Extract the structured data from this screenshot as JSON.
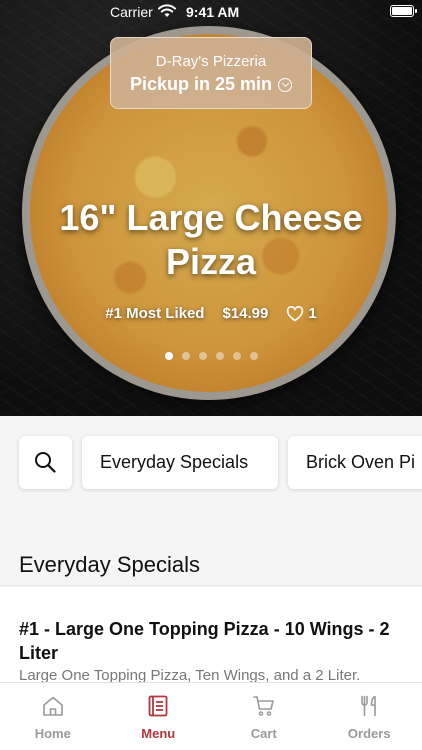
{
  "status_bar": {
    "carrier": "Carrier",
    "time": "9:41 AM"
  },
  "store": {
    "name": "D-Ray's Pizzeria",
    "pickup": "Pickup in 25 min"
  },
  "hero": {
    "title": "16\" Large Cheese Pizza",
    "badge": "#1 Most Liked",
    "price": "$14.99",
    "likes": "1",
    "carousel_total": 6,
    "carousel_active": 1
  },
  "categories": {
    "search_icon": "search-icon",
    "items": [
      {
        "label": "Everyday Specials"
      },
      {
        "label": "Brick Oven Pi"
      }
    ]
  },
  "section": {
    "title": "Everyday Specials"
  },
  "menu_item": {
    "title": "#1 -  Large One Topping Pizza - 10 Wings - 2 Liter",
    "description": "Large One Topping Pizza, Ten Wings, and a 2 Liter."
  },
  "tabs": [
    {
      "label": "Home",
      "icon": "home-icon",
      "active": false
    },
    {
      "label": "Menu",
      "icon": "menu-icon",
      "active": true
    },
    {
      "label": "Cart",
      "icon": "cart-icon",
      "active": false
    },
    {
      "label": "Orders",
      "icon": "orders-icon",
      "active": false
    }
  ],
  "colors": {
    "accent": "#b3363a",
    "pill": "#ceb091",
    "inactive_tab": "#9a9a9a"
  }
}
